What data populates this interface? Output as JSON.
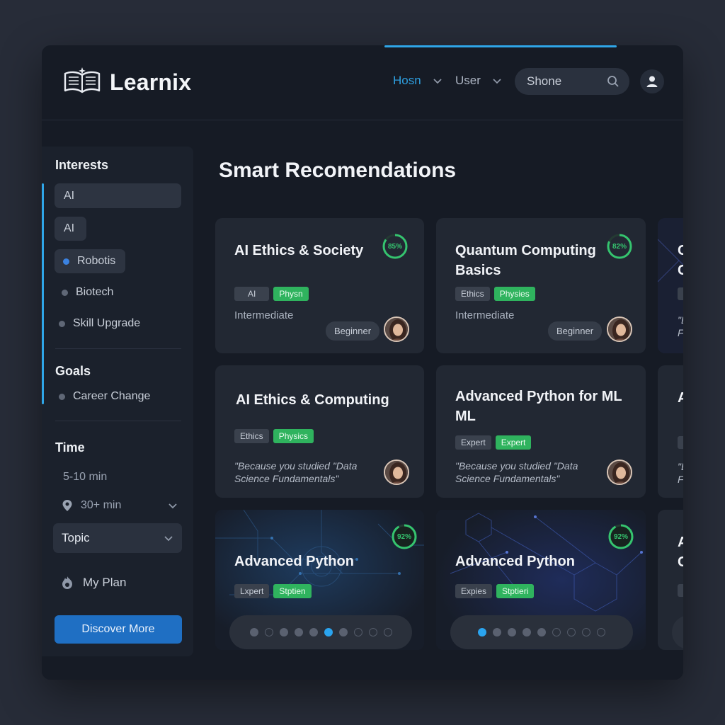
{
  "brand": {
    "name": "Learnix"
  },
  "nav": {
    "home": "Hosn",
    "user": "User"
  },
  "search": {
    "value": "Shone"
  },
  "sidebar": {
    "interests_heading": "Interests",
    "interests": [
      {
        "label": "AI"
      },
      {
        "label": "AI"
      },
      {
        "label": "Robotis"
      },
      {
        "label": "Biotech"
      },
      {
        "label": "Skill Upgrade"
      }
    ],
    "goals_heading": "Goals",
    "goals": [
      {
        "label": "Career Change"
      }
    ],
    "time_heading": "Time",
    "time": [
      {
        "label": "5-10 min"
      },
      {
        "label": "30+ min"
      }
    ],
    "topic_label": "Topic",
    "plan_label": "My Plan",
    "discover_label": "Discover More"
  },
  "main": {
    "title": "Smart Recomendations",
    "cards": [
      {
        "title": "AI Ethics & Society",
        "progress": "85%",
        "progress_value": 0.85,
        "tags": [
          "AI",
          "Physn"
        ],
        "level": "Intermediate",
        "pill": "Beginner"
      },
      {
        "title": "Quantum Computing Basics",
        "progress": "82%",
        "progress_value": 0.82,
        "tags": [
          "Ethics",
          "Physies"
        ],
        "level": "Intermediate",
        "pill": "Beginner"
      },
      {
        "title": "AI Ethics & Computing",
        "tags": [
          "Ethics",
          "Physics"
        ],
        "reason": "\"Because you studied \"Data Science Fundamentals\""
      },
      {
        "title": "Advanced Python for ML ML",
        "tags": [
          "Expert",
          "Expert"
        ],
        "reason": "\"Because you studied \"Data Science Fundamentals\""
      },
      {
        "title": "Advanced Python",
        "progress": "92%",
        "progress_value": 0.92,
        "tags": [
          "Lxpert",
          "Stptien"
        ]
      },
      {
        "title": "Advanced Python",
        "progress": "92%",
        "progress_value": 0.92,
        "tags": [
          "Expies",
          "Stptieri"
        ]
      }
    ],
    "partial_cards": [
      {
        "lines": [
          "C",
          "C"
        ],
        "reason_lines": [
          "\"E",
          "F"
        ]
      },
      {
        "lines": [
          "A"
        ],
        "reason_lines": [
          "\"E",
          "F"
        ]
      },
      {
        "lines": [
          "A",
          "C"
        ]
      }
    ]
  },
  "colors": {
    "accent": "#2fa6e8",
    "progress": "#35c46f",
    "tag_green": "#2fb35e",
    "discover": "#1f6fc3"
  }
}
